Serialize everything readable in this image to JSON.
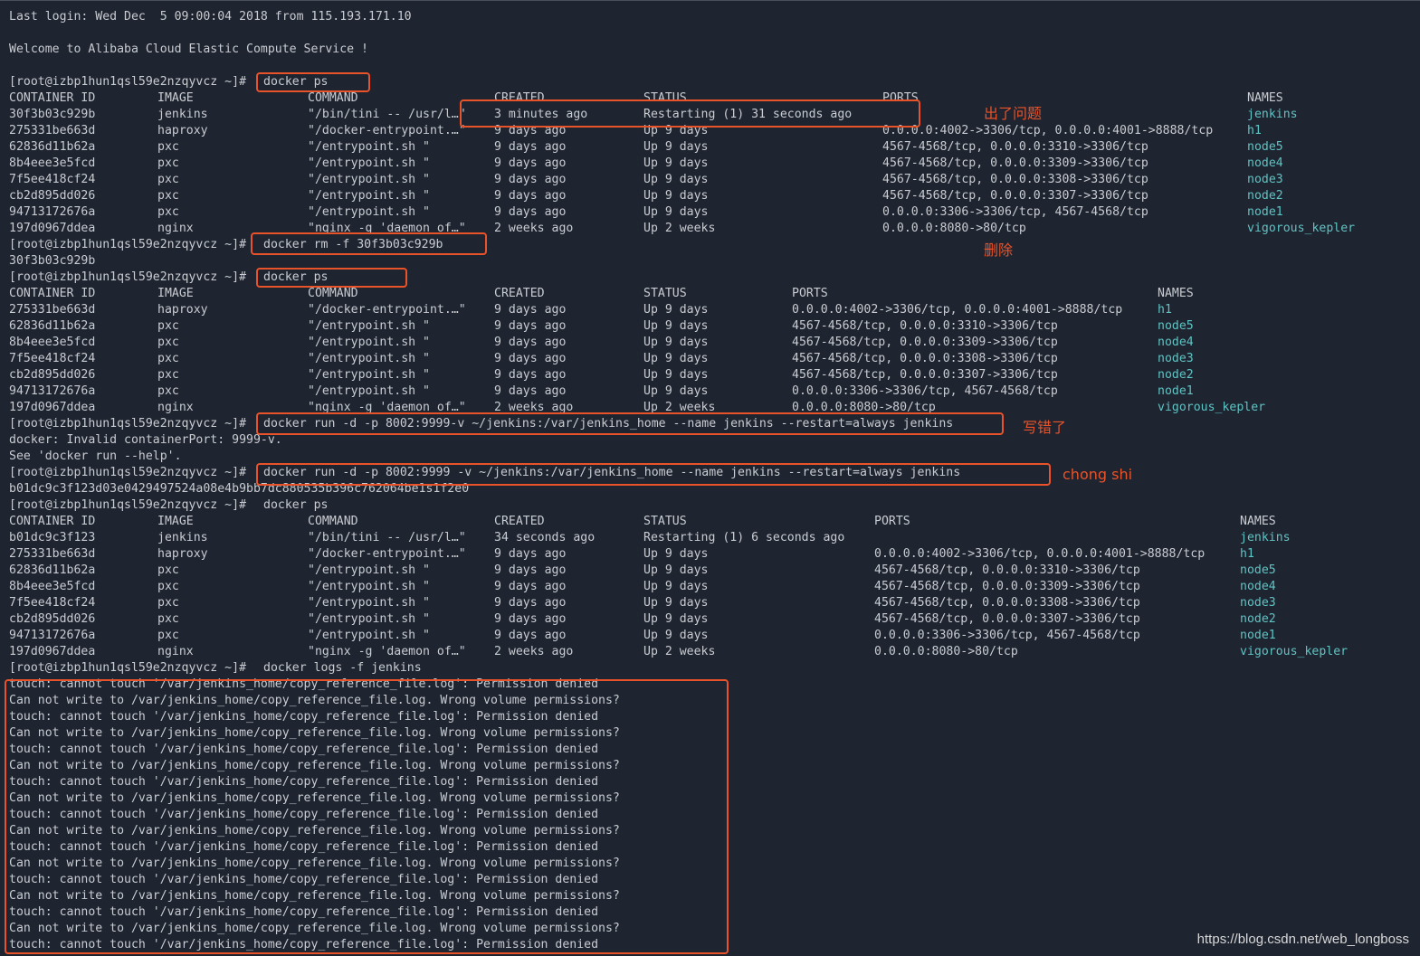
{
  "terminal": {
    "last_login": "Last login: Wed Dec  5 09:00:04 2018 from 115.193.171.10",
    "welcome": "Welcome to Alibaba Cloud Elastic Compute Service !",
    "prompt": "[root@izbp1hun1qsl59e2nzqyvcz ~]#",
    "colors": {
      "background": "#1e2430",
      "text": "#c9ccd1",
      "names_column": "#5fc4c4",
      "annotation": "#e8532a"
    },
    "headers": [
      "CONTAINER ID",
      "IMAGE",
      "COMMAND",
      "CREATED",
      "STATUS",
      "PORTS",
      "NAMES"
    ],
    "cmd1": "docker ps",
    "table1": [
      [
        "30f3b03c929b",
        "jenkins",
        "\"/bin/tini -- /usr/l…\"",
        "3 minutes ago",
        "Restarting (1) 31 seconds ago",
        "",
        "jenkins"
      ],
      [
        "275331be663d",
        "haproxy",
        "\"/docker-entrypoint.…\"",
        "9 days ago",
        "Up 9 days",
        "0.0.0.0:4002->3306/tcp, 0.0.0.0:4001->8888/tcp",
        "h1"
      ],
      [
        "62836d11b62a",
        "pxc",
        "\"/entrypoint.sh \"",
        "9 days ago",
        "Up 9 days",
        "4567-4568/tcp, 0.0.0.0:3310->3306/tcp",
        "node5"
      ],
      [
        "8b4eee3e5fcd",
        "pxc",
        "\"/entrypoint.sh \"",
        "9 days ago",
        "Up 9 days",
        "4567-4568/tcp, 0.0.0.0:3309->3306/tcp",
        "node4"
      ],
      [
        "7f5ee418cf24",
        "pxc",
        "\"/entrypoint.sh \"",
        "9 days ago",
        "Up 9 days",
        "4567-4568/tcp, 0.0.0.0:3308->3306/tcp",
        "node3"
      ],
      [
        "cb2d895dd026",
        "pxc",
        "\"/entrypoint.sh \"",
        "9 days ago",
        "Up 9 days",
        "4567-4568/tcp, 0.0.0.0:3307->3306/tcp",
        "node2"
      ],
      [
        "94713172676a",
        "pxc",
        "\"/entrypoint.sh \"",
        "9 days ago",
        "Up 9 days",
        "0.0.0.0:3306->3306/tcp, 4567-4568/tcp",
        "node1"
      ],
      [
        "197d0967ddea",
        "nginx",
        "\"nginx -g 'daemon of…\"",
        "2 weeks ago",
        "Up 2 weeks",
        "0.0.0.0:8080->80/tcp",
        "vigorous_kepler"
      ]
    ],
    "cmd2": "docker rm -f 30f3b03c929b",
    "out2": "30f3b03c929b",
    "cmd3": "docker ps",
    "table2": [
      [
        "275331be663d",
        "haproxy",
        "\"/docker-entrypoint.…\"",
        "9 days ago",
        "Up 9 days",
        "0.0.0.0:4002->3306/tcp, 0.0.0.0:4001->8888/tcp",
        "h1"
      ],
      [
        "62836d11b62a",
        "pxc",
        "\"/entrypoint.sh \"",
        "9 days ago",
        "Up 9 days",
        "4567-4568/tcp, 0.0.0.0:3310->3306/tcp",
        "node5"
      ],
      [
        "8b4eee3e5fcd",
        "pxc",
        "\"/entrypoint.sh \"",
        "9 days ago",
        "Up 9 days",
        "4567-4568/tcp, 0.0.0.0:3309->3306/tcp",
        "node4"
      ],
      [
        "7f5ee418cf24",
        "pxc",
        "\"/entrypoint.sh \"",
        "9 days ago",
        "Up 9 days",
        "4567-4568/tcp, 0.0.0.0:3308->3306/tcp",
        "node3"
      ],
      [
        "cb2d895dd026",
        "pxc",
        "\"/entrypoint.sh \"",
        "9 days ago",
        "Up 9 days",
        "4567-4568/tcp, 0.0.0.0:3307->3306/tcp",
        "node2"
      ],
      [
        "94713172676a",
        "pxc",
        "\"/entrypoint.sh \"",
        "9 days ago",
        "Up 9 days",
        "0.0.0.0:3306->3306/tcp, 4567-4568/tcp",
        "node1"
      ],
      [
        "197d0967ddea",
        "nginx",
        "\"nginx -g 'daemon of…\"",
        "2 weeks ago",
        "Up 2 weeks",
        "0.0.0.0:8080->80/tcp",
        "vigorous_kepler"
      ]
    ],
    "cmd4": "docker run -d -p 8002:9999-v ~/jenkins:/var/jenkins_home --name jenkins --restart=always jenkins",
    "out4a": "docker: Invalid containerPort: 9999-v.",
    "out4b": "See 'docker run --help'.",
    "cmd5": "docker run -d -p 8002:9999 -v ~/jenkins:/var/jenkins_home --name jenkins --restart=always jenkins",
    "out5": "b01dc9c3f123d03e0429497524a08e4b9bb7dc880535b396c762064be1s1f2e0",
    "cmd6": "docker ps",
    "table3": [
      [
        "b01dc9c3f123",
        "jenkins",
        "\"/bin/tini -- /usr/l…\"",
        "34 seconds ago",
        "Restarting (1) 6 seconds ago",
        "",
        "jenkins"
      ],
      [
        "275331be663d",
        "haproxy",
        "\"/docker-entrypoint.…\"",
        "9 days ago",
        "Up 9 days",
        "0.0.0.0:4002->3306/tcp, 0.0.0.0:4001->8888/tcp",
        "h1"
      ],
      [
        "62836d11b62a",
        "pxc",
        "\"/entrypoint.sh \"",
        "9 days ago",
        "Up 9 days",
        "4567-4568/tcp, 0.0.0.0:3310->3306/tcp",
        "node5"
      ],
      [
        "8b4eee3e5fcd",
        "pxc",
        "\"/entrypoint.sh \"",
        "9 days ago",
        "Up 9 days",
        "4567-4568/tcp, 0.0.0.0:3309->3306/tcp",
        "node4"
      ],
      [
        "7f5ee418cf24",
        "pxc",
        "\"/entrypoint.sh \"",
        "9 days ago",
        "Up 9 days",
        "4567-4568/tcp, 0.0.0.0:3308->3306/tcp",
        "node3"
      ],
      [
        "cb2d895dd026",
        "pxc",
        "\"/entrypoint.sh \"",
        "9 days ago",
        "Up 9 days",
        "4567-4568/tcp, 0.0.0.0:3307->3306/tcp",
        "node2"
      ],
      [
        "94713172676a",
        "pxc",
        "\"/entrypoint.sh \"",
        "9 days ago",
        "Up 9 days",
        "0.0.0.0:3306->3306/tcp, 4567-4568/tcp",
        "node1"
      ],
      [
        "197d0967ddea",
        "nginx",
        "\"nginx -g 'daemon of…\"",
        "2 weeks ago",
        "Up 2 weeks",
        "0.0.0.0:8080->80/tcp",
        "vigorous_kepler"
      ]
    ],
    "cmd7": "docker logs -f jenkins",
    "log_line_touch": "touch: cannot touch '/var/jenkins_home/copy_reference_file.log': Permission denied",
    "log_line_write": "Can not write to /var/jenkins_home/copy_reference_file.log. Wrong volume permissions?",
    "log_lines": [
      "touch: cannot touch '/var/jenkins_home/copy_reference_file.log': Permission denied",
      "Can not write to /var/jenkins_home/copy_reference_file.log. Wrong volume permissions?",
      "touch: cannot touch '/var/jenkins_home/copy_reference_file.log': Permission denied",
      "Can not write to /var/jenkins_home/copy_reference_file.log. Wrong volume permissions?",
      "touch: cannot touch '/var/jenkins_home/copy_reference_file.log': Permission denied",
      "Can not write to /var/jenkins_home/copy_reference_file.log. Wrong volume permissions?",
      "touch: cannot touch '/var/jenkins_home/copy_reference_file.log': Permission denied",
      "Can not write to /var/jenkins_home/copy_reference_file.log. Wrong volume permissions?",
      "touch: cannot touch '/var/jenkins_home/copy_reference_file.log': Permission denied",
      "Can not write to /var/jenkins_home/copy_reference_file.log. Wrong volume permissions?",
      "touch: cannot touch '/var/jenkins_home/copy_reference_file.log': Permission denied",
      "Can not write to /var/jenkins_home/copy_reference_file.log. Wrong volume permissions?",
      "touch: cannot touch '/var/jenkins_home/copy_reference_file.log': Permission denied",
      "Can not write to /var/jenkins_home/copy_reference_file.log. Wrong volume permissions?",
      "touch: cannot touch '/var/jenkins_home/copy_reference_file.log': Permission denied",
      "Can not write to /var/jenkins_home/copy_reference_file.log. Wrong volume permissions?",
      "touch: cannot touch '/var/jenkins_home/copy_reference_file.log': Permission denied"
    ]
  },
  "annotations": {
    "problem": "出了问题",
    "delete": "删除",
    "wrong": "写错了",
    "retry": "chong shi"
  },
  "watermark": "https://blog.csdn.net/web_longboss"
}
